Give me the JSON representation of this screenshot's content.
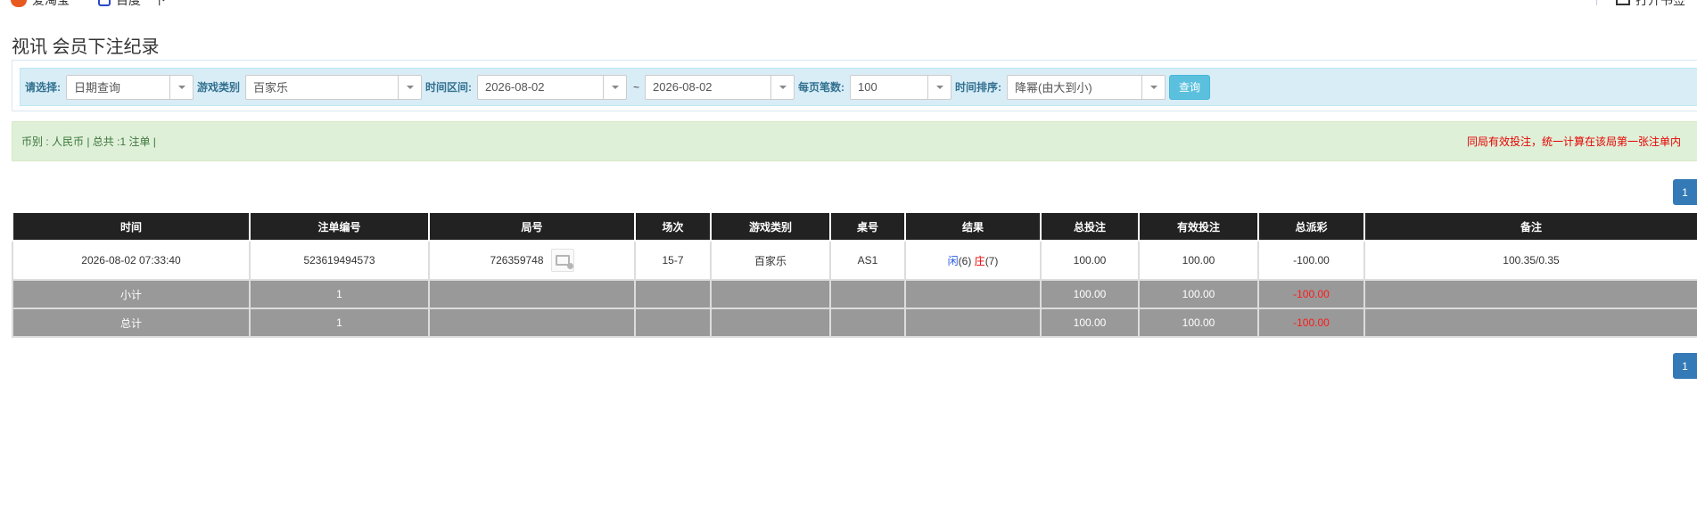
{
  "topbar": {
    "left_items": [
      "爱淘宝",
      "百度一下"
    ],
    "right_item": "打开书签"
  },
  "page_title": "视讯 会员下注纪录",
  "filters": {
    "select_label": "请选择:",
    "select_value": "日期查询",
    "game_type_label": "游戏类别",
    "game_type_value": "百家乐",
    "time_range_label": "时间区间:",
    "date_from": "2026-08-02",
    "range_sep": "~",
    "date_to": "2026-08-02",
    "per_page_label": "每页笔数:",
    "per_page_value": "100",
    "sort_label": "时间排序:",
    "sort_value": "降幂(由大到小)",
    "query_button": "查询"
  },
  "info": {
    "left": "币别 : 人民币 | 总共 :1 注单 |",
    "right": "同局有效投注，统一计算在该局第一张注单内"
  },
  "pagination": {
    "current_page": "1"
  },
  "table": {
    "headers": [
      "时间",
      "注单编号",
      "局号",
      "场次",
      "游戏类别",
      "桌号",
      "结果",
      "总投注",
      "有效投注",
      "总派彩",
      "备注"
    ],
    "row": {
      "time": "2026-08-02 07:33:40",
      "bet_id": "523619494573",
      "round_no": "726359748",
      "session": "15-7",
      "game_type": "百家乐",
      "table_no": "AS1",
      "result_player": "闲",
      "result_player_score": "(6)",
      "result_banker": "庄",
      "result_banker_score": "(7)",
      "total_bet": "100.00",
      "valid_bet": "100.00",
      "payout": "-100.00",
      "remark": "100.35/0.35"
    },
    "subtotal": {
      "label": "小计",
      "count": "1",
      "total_bet": "100.00",
      "valid_bet": "100.00",
      "payout": "-100.00"
    },
    "total": {
      "label": "总计",
      "count": "1",
      "total_bet": "100.00",
      "valid_bet": "100.00",
      "payout": "-100.00"
    }
  },
  "colors": {
    "header_bg": "#222222",
    "filter_bg": "#d9edf7",
    "info_bg": "#dff0d8",
    "accent_blue": "#337ab7",
    "negative_red": "#e60000"
  }
}
